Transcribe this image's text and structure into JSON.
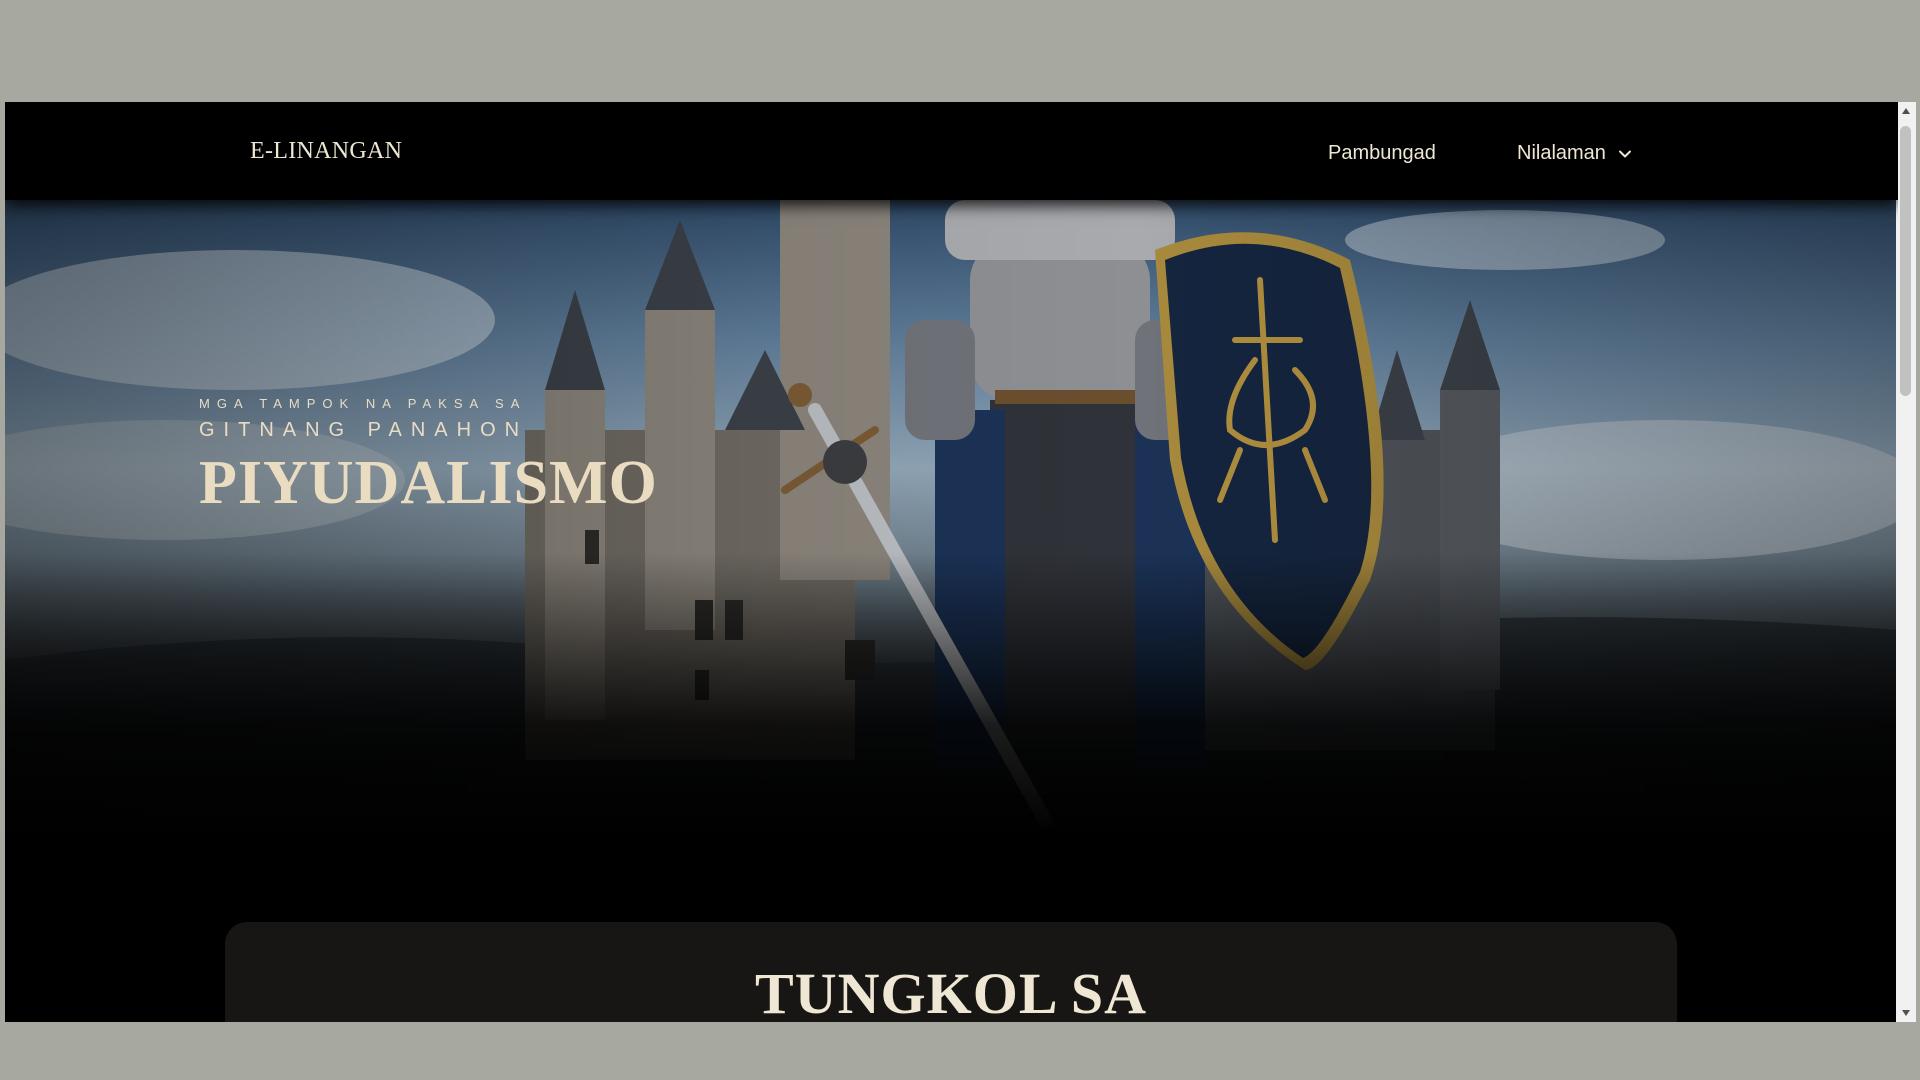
{
  "navbar": {
    "brand": "E-LINANGAN",
    "links": [
      {
        "label": "Pambungad"
      },
      {
        "label": "Nilalaman",
        "icon": "chevron-down-icon"
      }
    ]
  },
  "hero": {
    "kicker_small": "MGA TAMPOK NA PAKSA SA",
    "kicker_large": "GITNANG PANAHON",
    "title": "PIYUDALISMO"
  },
  "about": {
    "title": "TUNGKOL SA"
  },
  "colors": {
    "text_cream": "#e9dcc1",
    "background": "#000000",
    "card": "#171614",
    "highlight_annotation": "#ee8a4e"
  }
}
